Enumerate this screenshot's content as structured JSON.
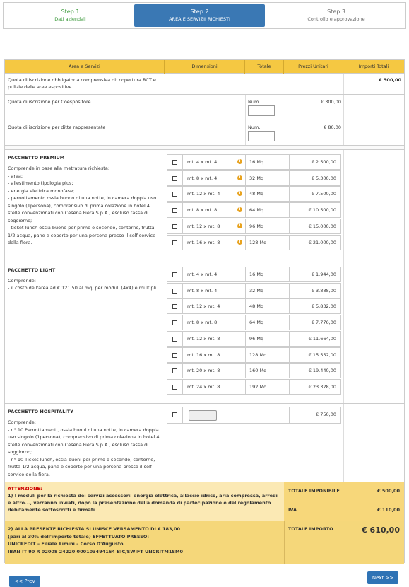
{
  "wizard": {
    "steps": [
      {
        "title": "Step 1",
        "subtitle": "Dati aziendali"
      },
      {
        "title": "Step 2",
        "subtitle": "AREA E SERVIZII RICHIESTI"
      },
      {
        "title": "Step 3",
        "subtitle": "Controllo e approvazione"
      }
    ]
  },
  "table": {
    "headers": [
      "Area e Servizi",
      "Dimensioni",
      "Totale",
      "Prezzi Unitari",
      "Importi Totali"
    ],
    "quota": {
      "desc": "Quota di iscrizione obbligatoria comprensiva di: copertura RCT e pulizie delle aree espositive.",
      "total": "€ 500,00"
    },
    "coespositore": {
      "desc": "Quota di iscrizione per Coespositore",
      "num_label": "Num.",
      "price": "€ 300,00"
    },
    "ditte": {
      "desc": "Quota di iscrizione per ditte rappresentate",
      "num_label": "Num.",
      "price": "€ 80,00"
    },
    "premium": {
      "title": "PACCHETTO PREMIUM",
      "desc": "Comprende in base alla metratura richiesta:\n- area;\n- allestimento tipologia plus;\n- energia elettrica monofase;\n- pernottamento ossia buono di una notte, in camera doppia uso singolo (1persona), comprensivo di prima colazione in hotel 4 stelle convenzionati con Cesena Fiera S.p.A., escluso tassa di soggiorno;\n- ticket lunch ossia buono per primo o secondo, contorno, frutta 1/2 acqua, pane e coperto per una persona presso il self-service della fiera.",
      "items": [
        {
          "dim": "mt. 4 x mt. 4",
          "tot": "16 Mq",
          "price": "€ 2.500,00"
        },
        {
          "dim": "mt. 8 x mt. 4",
          "tot": "32 Mq",
          "price": "€ 5.300,00"
        },
        {
          "dim": "mt. 12 x mt. 4",
          "tot": "48 Mq",
          "price": "€ 7.500,00"
        },
        {
          "dim": "mt. 8 x mt. 8",
          "tot": "64 Mq",
          "price": "€ 10.500,00"
        },
        {
          "dim": "mt. 12 x mt. 8",
          "tot": "96 Mq",
          "price": "€ 15.000,00"
        },
        {
          "dim": "mt. 16 x mt. 8",
          "tot": "128 Mq",
          "price": "€ 21.000,00"
        }
      ]
    },
    "light": {
      "title": "PACCHETTO LIGHT",
      "desc": "Comprende:\n- il costo dell'area ad € 121,50 al mq, per moduli (4x4) e multipli.",
      "items": [
        {
          "dim": "mt. 4 x mt. 4",
          "tot": "16 Mq",
          "price": "€ 1.944,00"
        },
        {
          "dim": "mt. 8 x mt. 4",
          "tot": "32 Mq",
          "price": "€ 3.888,00"
        },
        {
          "dim": "mt. 12 x mt. 4",
          "tot": "48 Mq",
          "price": "€ 5.832,00"
        },
        {
          "dim": "mt. 8 x mt. 8",
          "tot": "64 Mq",
          "price": "€ 7.776,00"
        },
        {
          "dim": "mt. 12 x mt. 8",
          "tot": "96 Mq",
          "price": "€ 11.664,00"
        },
        {
          "dim": "mt. 16 x mt. 8",
          "tot": "128 Mq",
          "price": "€ 15.552,00"
        },
        {
          "dim": "mt. 20 x mt. 8",
          "tot": "160 Mq",
          "price": "€ 19.440,00"
        },
        {
          "dim": "mt. 24 x mt. 8",
          "tot": "192 Mq",
          "price": "€ 23.328,00"
        }
      ]
    },
    "hospitality": {
      "title": "PACCHETTO HOSPITALITY",
      "desc": "Comprende:\n- n° 10 Pernottamenti, ossia buoni di una notte, in camera doppia uso singolo (1persona), comprensivo di prima colazione in hotel 4 stelle convenzionati con Cesena Fiera S.p.A., escluso tassa di soggiorno;\n- n° 10 Ticket lunch, ossia buoni per primo o secondo, contorno, frutta 1/2 acqua, pane e coperto per una persona presso il self-service della fiera.",
      "price": "€ 750,00"
    },
    "attenzione": {
      "title": "ATTENZIONE:",
      "text": "1) I moduli per la richiesta dei servizi accessori: energia elettrica, allaccio idrico, aria compressa, arredi e altro..., verranno inviati, dopo la presentazione della domanda di partecipazione e del regolamento debitamente sottoscritti e firmati"
    },
    "totals": {
      "imponibile_label": "TOTALE IMPONIBILE",
      "imponibile": "€ 500,00",
      "iva_label": "IVA",
      "iva": "€ 110,00",
      "importo_label": "TOTALE IMPORTO",
      "importo": "€ 610,00"
    },
    "versamento": "2) ALLA PRESENTE RICHIESTA SI UNISCE VERSAMENTO DI € 183,00\n(pari al 30% dell'importo totale) EFFETTUATO PRESSO:\nUNICREDIT – Filiale Rimini – Corso D'Augusto\nIBAN IT 90 R 02008 24220 000103494164 BIC/SWIFT UNCRITM1SM0"
  },
  "nav": {
    "prev": "<< Prev",
    "next": "Next >>"
  }
}
